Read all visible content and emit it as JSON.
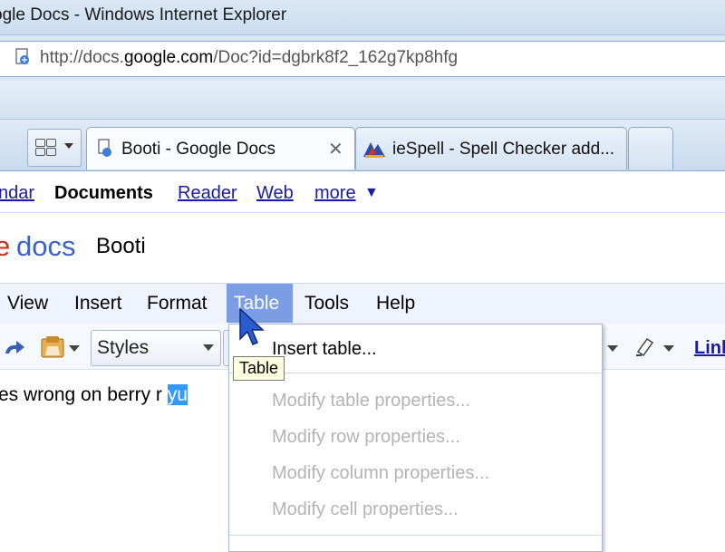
{
  "window": {
    "title": "ogle Docs - Windows Internet Explorer"
  },
  "address_bar": {
    "url_prefix": "http://docs.",
    "url_domain": "google.com",
    "url_suffix": "/Doc?id=dgbrk8f2_162g7kp8hfg"
  },
  "tabs": [
    {
      "label": "Booti - Google Docs",
      "active": true
    },
    {
      "label": "ieSpell - Spell Checker add...",
      "active": false
    }
  ],
  "google_bar": {
    "items": [
      "ndar",
      "Documents",
      "Reader",
      "Web",
      "more"
    ],
    "more_arrow": "▼"
  },
  "docs_header": {
    "logo_e": "e",
    "logo_docs": "docs",
    "doc_title": "Booti"
  },
  "menu_bar": {
    "items": [
      "View",
      "Insert",
      "Format",
      "Table",
      "Tools",
      "Help"
    ],
    "open_menu": "Table"
  },
  "toolbar": {
    "styles_label": "Styles",
    "link_label": "Link"
  },
  "document": {
    "text_before": "es wrong on berry r ",
    "text_selected": "yu"
  },
  "table_menu": {
    "items": [
      {
        "label": "Insert table...",
        "enabled": true
      },
      {
        "label": "Modify table properties...",
        "enabled": false
      },
      {
        "label": "Modify row properties...",
        "enabled": false
      },
      {
        "label": "Modify column properties...",
        "enabled": false
      },
      {
        "label": "Modify cell properties...",
        "enabled": false
      }
    ]
  },
  "tooltip": {
    "text": "Table"
  },
  "colors": {
    "menu_highlight": "#7b9de6",
    "link": "#1a1aa6",
    "selection": "#3399ff",
    "disabled_text": "#b4b4b4"
  }
}
